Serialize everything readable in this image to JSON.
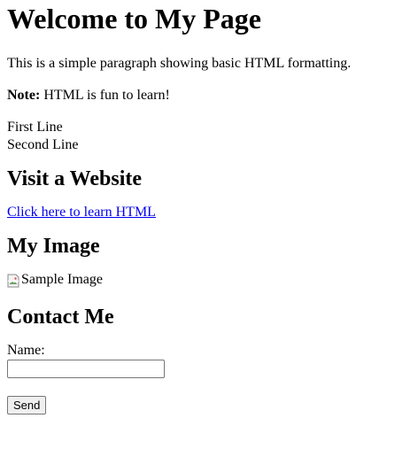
{
  "heading": {
    "title": "Welcome to My Page"
  },
  "intro": {
    "text": "This is a simple paragraph showing basic HTML formatting."
  },
  "note": {
    "label": "Note:",
    "text": " HTML is fun to learn!"
  },
  "lines": {
    "first": "First Line",
    "second": "Second Line"
  },
  "visit": {
    "heading": "Visit a Website",
    "link_text": "Click here to learn HTML"
  },
  "image_section": {
    "heading": "My Image",
    "alt_text": "Sample Image",
    "icon": "broken-image-icon"
  },
  "contact": {
    "heading": "Contact Me",
    "name_label": "Name:",
    "name_value": "",
    "send_label": "Send"
  },
  "colors": {
    "link": "#0000ee",
    "text": "#000000",
    "background": "#ffffff"
  }
}
